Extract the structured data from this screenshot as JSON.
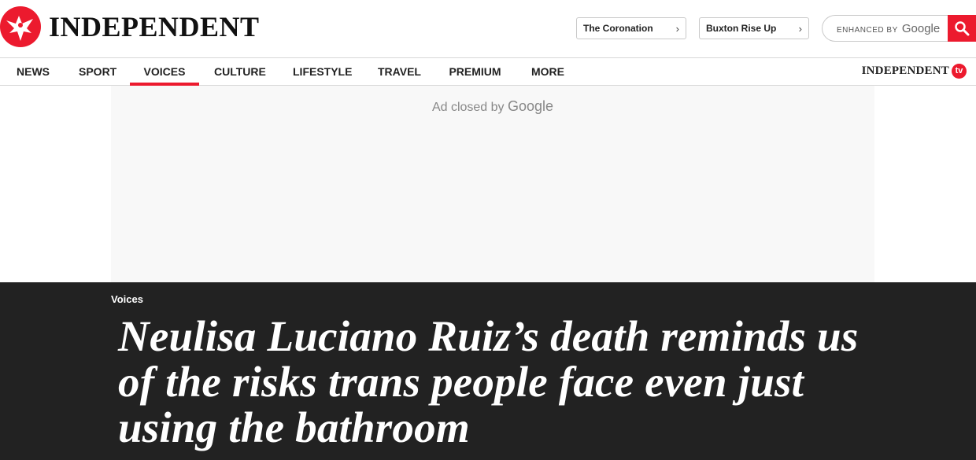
{
  "brand": {
    "name": "INDEPENDENT",
    "tv_name": "INDEPENDENT",
    "tv_badge": "tv",
    "accent": "#ec1a2e",
    "logo_icon": "eagle-icon"
  },
  "header": {
    "pills": [
      {
        "label": "The Coronation",
        "icon": "chevron-right-icon"
      },
      {
        "label": "Buxton Rise Up",
        "icon": "chevron-right-icon"
      }
    ],
    "search": {
      "enhanced_label": "ENHANCED BY",
      "google_label": "Google",
      "button_icon": "search-icon"
    }
  },
  "nav": {
    "items": [
      {
        "label": "NEWS"
      },
      {
        "label": "SPORT"
      },
      {
        "label": "VOICES",
        "active": true
      },
      {
        "label": "CULTURE"
      },
      {
        "label": "LIFESTYLE"
      },
      {
        "label": "TRAVEL"
      },
      {
        "label": "PREMIUM"
      },
      {
        "label": "MORE"
      }
    ]
  },
  "ad": {
    "text": "Ad closed by",
    "brand": "Google"
  },
  "article": {
    "section": "Voices",
    "headline": "Neulisa Luciano Ruiz’s death reminds us of the risks trans people face even just using the bathroom"
  }
}
